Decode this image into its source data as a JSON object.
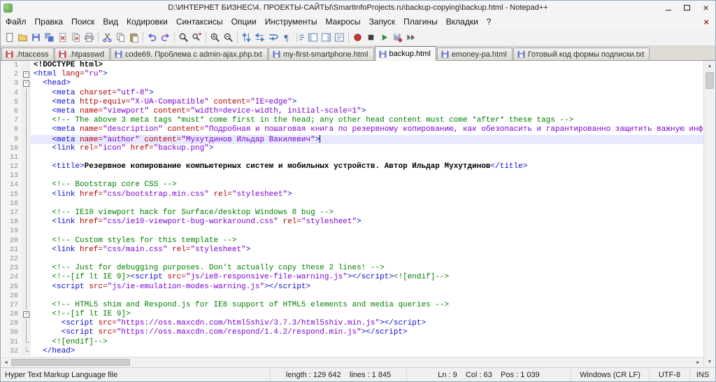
{
  "window": {
    "title": "D:\\ИНТЕРНЕТ БИЗНЕС\\4. ПРОЕКТЫ-САЙТЫ\\SmartInfoProjects.ru\\backup-copying\\backup.html - Notepad++"
  },
  "menu": {
    "items": [
      "Файл",
      "Правка",
      "Поиск",
      "Вид",
      "Кодировки",
      "Синтаксисы",
      "Опции",
      "Инструменты",
      "Макросы",
      "Запуск",
      "Плагины",
      "Вкладки",
      "?"
    ]
  },
  "toolbar": {
    "icons": [
      "new-file",
      "open",
      "save",
      "save-all",
      "close",
      "close-all",
      "print",
      "|",
      "cut",
      "copy",
      "paste",
      "|",
      "undo",
      "redo",
      "|",
      "find",
      "replace",
      "|",
      "zoom-in",
      "zoom-out",
      "|",
      "sync-vertical-scroll",
      "sync-horizontal-scroll",
      "word-wrap",
      "show-all-characters",
      "show-indent-guide",
      "function-list",
      "document-map",
      "doc-switcher",
      "|",
      "macro-record",
      "macro-stop",
      "macro-play",
      "macro-save",
      "macro-run"
    ]
  },
  "tabs": [
    {
      "label": ".htaccess",
      "active": false,
      "modified": true
    },
    {
      "label": ".htpasswd",
      "active": false,
      "modified": true
    },
    {
      "label": "code69. Проблема с admin-ajax.php.txt",
      "active": false,
      "modified": false
    },
    {
      "label": "my-first-smartphone.html",
      "active": false,
      "modified": false
    },
    {
      "label": "backup.html",
      "active": true,
      "modified": false
    },
    {
      "label": "emoney-pa.html",
      "active": false,
      "modified": false
    },
    {
      "label": "Готовый код формы подписки.txt",
      "active": false,
      "modified": false
    }
  ],
  "editor": {
    "current_line": 9,
    "colors": {
      "tag": "#0a0ad2",
      "attribute": "#b40000",
      "string": "#7c00d4",
      "comment": "#008000",
      "text": "#000000",
      "current_line_bg": "#e8e8ff"
    },
    "lines": [
      {
        "f": "",
        "s": [
          [
            "k",
            "<!DOCTYPE html>"
          ]
        ]
      },
      {
        "f": "b",
        "s": [
          [
            "t",
            "<html "
          ],
          [
            "a",
            "lang="
          ],
          [
            "s",
            "\"ru\""
          ],
          [
            "t",
            ">"
          ]
        ]
      },
      {
        "f": "b",
        "s": [
          [
            "p",
            "  "
          ],
          [
            "t",
            "<head>"
          ]
        ]
      },
      {
        "f": "v",
        "s": [
          [
            "p",
            "    "
          ],
          [
            "t",
            "<meta "
          ],
          [
            "a",
            "charset="
          ],
          [
            "s",
            "\"utf-8\""
          ],
          [
            "t",
            ">"
          ]
        ]
      },
      {
        "f": "v",
        "s": [
          [
            "p",
            "    "
          ],
          [
            "t",
            "<meta "
          ],
          [
            "a",
            "http-equiv="
          ],
          [
            "s",
            "\"X-UA-Compatible\""
          ],
          [
            "a",
            " content="
          ],
          [
            "s",
            "\"IE=edge\""
          ],
          [
            "t",
            ">"
          ]
        ]
      },
      {
        "f": "v",
        "s": [
          [
            "p",
            "    "
          ],
          [
            "t",
            "<meta "
          ],
          [
            "a",
            "name="
          ],
          [
            "s",
            "\"viewport\""
          ],
          [
            "a",
            " content="
          ],
          [
            "s",
            "\"width=device-width, initial-scale=1\""
          ],
          [
            "t",
            ">"
          ]
        ]
      },
      {
        "f": "v",
        "s": [
          [
            "p",
            "    "
          ],
          [
            "c",
            "<!-- The above 3 meta tags *must* come first in the head; any other head content must come *after* these tags -->"
          ]
        ]
      },
      {
        "f": "v",
        "s": [
          [
            "p",
            "    "
          ],
          [
            "t",
            "<meta "
          ],
          [
            "a",
            "name="
          ],
          [
            "s",
            "\"description\""
          ],
          [
            "a",
            " content="
          ],
          [
            "s",
            "\"Подробная и пошаговая книга по резервному копированию, как обезопасить и гарантированно защитить важную информацию от внез"
          ]
        ]
      },
      {
        "f": "v",
        "s": [
          [
            "p",
            "    "
          ],
          [
            "t",
            "<meta "
          ],
          [
            "a",
            "name="
          ],
          [
            "s",
            "\"author\""
          ],
          [
            "a",
            " content="
          ],
          [
            "s",
            "\"Мухутдинов Ильдар Вакилевич\""
          ],
          [
            "t",
            ">"
          ]
        ]
      },
      {
        "f": "v",
        "s": [
          [
            "p",
            "    "
          ],
          [
            "t",
            "<link "
          ],
          [
            "a",
            "rel="
          ],
          [
            "s",
            "\"icon\""
          ],
          [
            "a",
            " href="
          ],
          [
            "s",
            "\"backup.png\""
          ],
          [
            "t",
            ">"
          ]
        ]
      },
      {
        "f": "v",
        "s": []
      },
      {
        "f": "v",
        "s": [
          [
            "p",
            "    "
          ],
          [
            "t",
            "<title>"
          ],
          [
            "x",
            "Резервное копирование компьютерных систем и мобильных устройств. Автор Ильдар Мухутдинов"
          ],
          [
            "t",
            "</title>"
          ]
        ]
      },
      {
        "f": "v",
        "s": []
      },
      {
        "f": "v",
        "s": [
          [
            "p",
            "    "
          ],
          [
            "c",
            "<!-- Bootstrap core CSS -->"
          ]
        ]
      },
      {
        "f": "v",
        "s": [
          [
            "p",
            "    "
          ],
          [
            "t",
            "<link "
          ],
          [
            "a",
            "href="
          ],
          [
            "s",
            "\"css/bootstrap.min.css\""
          ],
          [
            "a",
            " rel="
          ],
          [
            "s",
            "\"stylesheet\""
          ],
          [
            "t",
            ">"
          ]
        ]
      },
      {
        "f": "v",
        "s": []
      },
      {
        "f": "v",
        "s": [
          [
            "p",
            "    "
          ],
          [
            "c",
            "<!-- IE10 viewport hack for Surface/desktop Windows 8 bug -->"
          ]
        ]
      },
      {
        "f": "v",
        "s": [
          [
            "p",
            "    "
          ],
          [
            "t",
            "<link "
          ],
          [
            "a",
            "href="
          ],
          [
            "s",
            "\"css/ie10-viewport-bug-workaround.css\""
          ],
          [
            "a",
            " rel="
          ],
          [
            "s",
            "\"stylesheet\""
          ],
          [
            "t",
            ">"
          ]
        ]
      },
      {
        "f": "v",
        "s": []
      },
      {
        "f": "v",
        "s": [
          [
            "p",
            "    "
          ],
          [
            "c",
            "<!-- Custom styles for this template -->"
          ]
        ]
      },
      {
        "f": "v",
        "s": [
          [
            "p",
            "    "
          ],
          [
            "t",
            "<link "
          ],
          [
            "a",
            "href="
          ],
          [
            "s",
            "\"css/main.css\""
          ],
          [
            "a",
            " rel="
          ],
          [
            "s",
            "\"stylesheet\""
          ],
          [
            "t",
            ">"
          ]
        ]
      },
      {
        "f": "v",
        "s": []
      },
      {
        "f": "v",
        "s": [
          [
            "p",
            "    "
          ],
          [
            "c",
            "<!-- Just for debugging purposes. Don't actually copy these 2 lines! -->"
          ]
        ]
      },
      {
        "f": "v",
        "s": [
          [
            "p",
            "    "
          ],
          [
            "c",
            "<!--[if lt IE 9]>"
          ],
          [
            "t",
            "<script "
          ],
          [
            "a",
            "src="
          ],
          [
            "s",
            "\"js/ie8-responsive-file-warning.js\""
          ],
          [
            "t",
            "></script>"
          ],
          [
            "c",
            "<![endif]-->"
          ]
        ]
      },
      {
        "f": "v",
        "s": [
          [
            "p",
            "    "
          ],
          [
            "t",
            "<script "
          ],
          [
            "a",
            "src="
          ],
          [
            "s",
            "\"js/ie-emulation-modes-warning.js\""
          ],
          [
            "t",
            "></script>"
          ]
        ]
      },
      {
        "f": "v",
        "s": []
      },
      {
        "f": "v",
        "s": [
          [
            "p",
            "    "
          ],
          [
            "c",
            "<!-- HTML5 shim and Respond.js for IE8 support of HTML5 elements and media queries -->"
          ]
        ]
      },
      {
        "f": "b",
        "s": [
          [
            "p",
            "    "
          ],
          [
            "c",
            "<!--[if lt IE 9]>"
          ]
        ]
      },
      {
        "f": "v",
        "s": [
          [
            "p",
            "      "
          ],
          [
            "t",
            "<script "
          ],
          [
            "a",
            "src="
          ],
          [
            "s",
            "\"https://oss.maxcdn.com/html5shiv/3.7.3/html5shiv.min.js\""
          ],
          [
            "t",
            "></script>"
          ]
        ]
      },
      {
        "f": "v",
        "s": [
          [
            "p",
            "      "
          ],
          [
            "t",
            "<script "
          ],
          [
            "a",
            "src="
          ],
          [
            "s",
            "\"https://oss.maxcdn.com/respond/1.4.2/respond.min.js\""
          ],
          [
            "t",
            "></script>"
          ]
        ]
      },
      {
        "f": "e",
        "s": [
          [
            "p",
            "    "
          ],
          [
            "c",
            "<![endif]-->"
          ]
        ]
      },
      {
        "f": "e",
        "s": [
          [
            "p",
            "  "
          ],
          [
            "t",
            "</head>"
          ]
        ]
      }
    ]
  },
  "status_bar": {
    "doc_type": "Hyper Text Markup Language file",
    "length_lines": "length : 129 642    lines : 1 845",
    "position": "Ln : 9    Col : 63    Pos : 1 039",
    "eol": "Windows (CR LF)",
    "encoding": "UTF-8",
    "mode": "INS"
  }
}
